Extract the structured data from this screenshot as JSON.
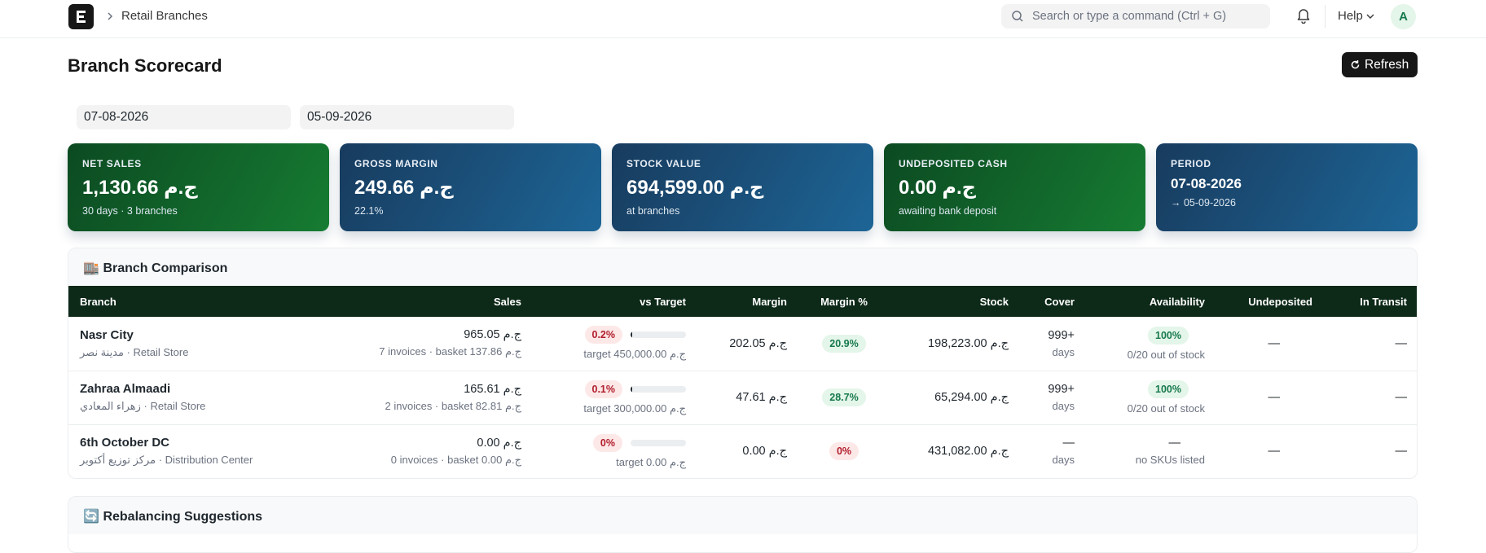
{
  "navbar": {
    "breadcrumb": "Retail Branches",
    "search_placeholder": "Search or type a command (Ctrl + G)",
    "help_label": "Help",
    "avatar_initial": "A"
  },
  "header": {
    "title": "Branch Scorecard",
    "refresh_label": "Refresh"
  },
  "filters": {
    "from_date": "07-08-2026",
    "to_date": "05-09-2026"
  },
  "kpis": [
    {
      "label": "NET SALES",
      "value": "1,130.66 ج.م",
      "sub": "30 days · 3 branches",
      "theme": "green"
    },
    {
      "label": "GROSS MARGIN",
      "value": "249.66 ج.م",
      "sub": "22.1%",
      "theme": "blue"
    },
    {
      "label": "STOCK VALUE",
      "value": "694,599.00 ج.م",
      "sub": "at branches",
      "theme": "blue"
    },
    {
      "label": "UNDEPOSITED CASH",
      "value": "0.00 ج.م",
      "sub": "awaiting bank deposit",
      "theme": "green"
    },
    {
      "label": "PERIOD",
      "value": "07-08-2026",
      "sub": "→ 05-09-2026",
      "theme": "blue"
    }
  ],
  "comparison": {
    "title": "Branch Comparison",
    "emoji": "🏬",
    "columns": [
      "Branch",
      "Sales",
      "vs Target",
      "Margin",
      "Margin %",
      "Stock",
      "Cover",
      "Availability",
      "Undeposited",
      "In Transit"
    ],
    "rows": [
      {
        "name": "Nasr City",
        "sub": "مدينة نصر · Retail Store",
        "sales": "965.05 ج.م",
        "sales_sub": "7 invoices · basket 137.86 ج.م",
        "vs_target_pct": "0.2%",
        "vs_target_fraction": 0.002,
        "target_sub": "target 450,000.00 ج.م",
        "margin": "202.05 ج.م",
        "margin_pct": "20.9%",
        "margin_pct_state": "green",
        "stock": "198,223.00 ج.م",
        "cover": "999+",
        "cover_sub": "days",
        "availability": "100%",
        "availability_state": "green",
        "availability_sub": "0/20 out of stock",
        "undeposited": "—",
        "in_transit": "—"
      },
      {
        "name": "Zahraa Almaadi",
        "sub": "زهراء المعادي · Retail Store",
        "sales": "165.61 ج.م",
        "sales_sub": "2 invoices · basket 82.81 ج.م",
        "vs_target_pct": "0.1%",
        "vs_target_fraction": 0.001,
        "target_sub": "target 300,000.00 ج.م",
        "margin": "47.61 ج.م",
        "margin_pct": "28.7%",
        "margin_pct_state": "green",
        "stock": "65,294.00 ج.م",
        "cover": "999+",
        "cover_sub": "days",
        "availability": "100%",
        "availability_state": "green",
        "availability_sub": "0/20 out of stock",
        "undeposited": "—",
        "in_transit": "—"
      },
      {
        "name": "6th October DC",
        "sub": "مركز توزيع أكتوبر · Distribution Center",
        "sales": "0.00 ج.م",
        "sales_sub": "0 invoices · basket 0.00 ج.م",
        "vs_target_pct": "0%",
        "vs_target_fraction": 0,
        "target_sub": "target 0.00 ج.م",
        "margin": "0.00 ج.م",
        "margin_pct": "0%",
        "margin_pct_state": "red",
        "stock": "431,082.00 ج.م",
        "cover": "—",
        "cover_sub": "days",
        "availability": "—",
        "availability_state": "plain",
        "availability_sub": "no SKUs listed",
        "undeposited": "—",
        "in_transit": "—"
      }
    ]
  },
  "rebalancing": {
    "title": "Rebalancing Suggestions",
    "emoji": "🔄"
  },
  "colors": {
    "accent_dark": "#171717",
    "kpi_green": "#167c32",
    "kpi_blue": "#1d6596",
    "table_header": "#0d2918",
    "pill_green_text": "#16794c",
    "pill_red_text": "#b11d2b"
  },
  "icons": [
    "app-logo-icon",
    "chevron-right-icon",
    "search-icon",
    "bell-icon",
    "chevron-down-icon",
    "refresh-icon"
  ]
}
